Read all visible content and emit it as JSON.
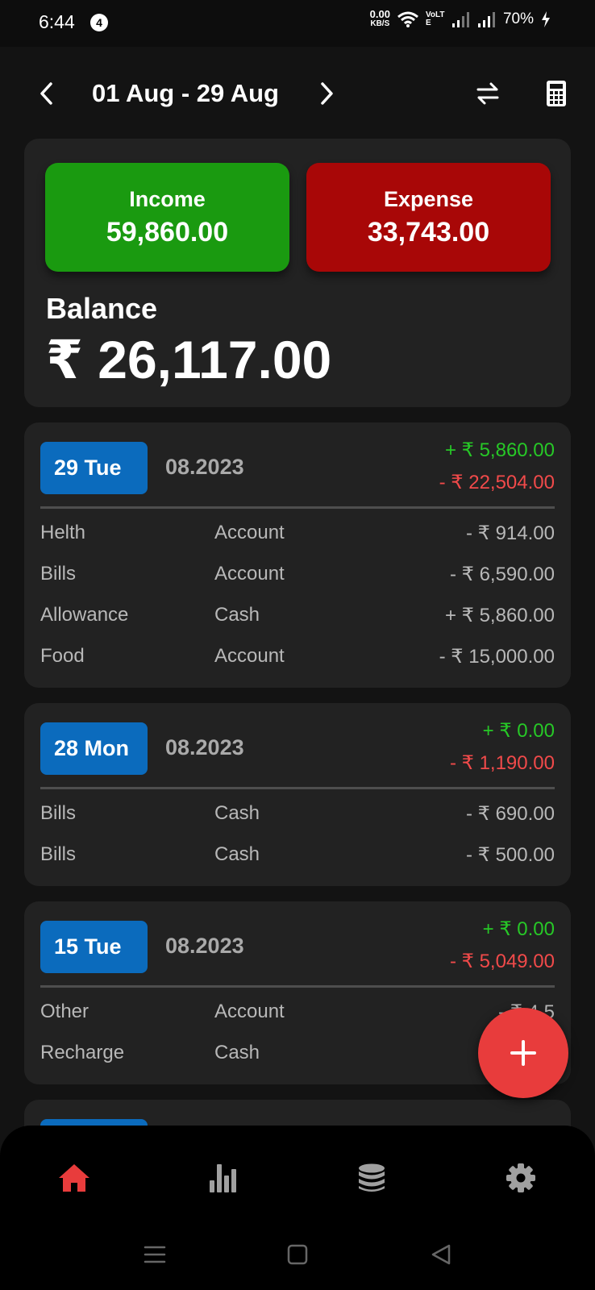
{
  "status_bar": {
    "time": "6:44",
    "notification_count": "4",
    "net_speed": "0.00",
    "net_speed_unit": "KB/S",
    "volte": "VoLTE",
    "battery": "70%"
  },
  "header": {
    "date_range": "01 Aug - 29 Aug",
    "icons": [
      "chevron-left-icon",
      "chevron-right-icon",
      "swap-icon",
      "calculator-icon"
    ]
  },
  "summary": {
    "income_label": "Income",
    "income_value": "59,860.00",
    "expense_label": "Expense",
    "expense_value": "33,743.00",
    "balance_label": "Balance",
    "balance_value": "₹ 26,117.00"
  },
  "days": [
    {
      "date": "29 Tue",
      "month_year": "08.2023",
      "income": "+ ₹ 5,860.00",
      "expense": "- ₹ 22,504.00",
      "transactions": [
        {
          "category": "Helth",
          "account": "Account",
          "amount": "- ₹ 914.00"
        },
        {
          "category": "Bills",
          "account": "Account",
          "amount": "- ₹ 6,590.00"
        },
        {
          "category": "Allowance",
          "account": "Cash",
          "amount": "+ ₹ 5,860.00"
        },
        {
          "category": "Food",
          "account": "Account",
          "amount": "- ₹ 15,000.00"
        }
      ]
    },
    {
      "date": "28 Mon",
      "month_year": "08.2023",
      "income": "+ ₹ 0.00",
      "expense": "- ₹ 1,190.00",
      "transactions": [
        {
          "category": "Bills",
          "account": "Cash",
          "amount": "- ₹ 690.00"
        },
        {
          "category": "Bills",
          "account": "Cash",
          "amount": "- ₹ 500.00"
        }
      ]
    },
    {
      "date": "15 Tue",
      "month_year": "08.2023",
      "income": "+ ₹ 0.00",
      "expense": "- ₹ 5,049.00",
      "transactions": [
        {
          "category": "Other",
          "account": "Account",
          "amount": "- ₹ 4,5"
        },
        {
          "category": "Recharge",
          "account": "Cash",
          "amount": "- "
        }
      ]
    }
  ],
  "bottom_nav": [
    "home-icon",
    "stats-icon",
    "accounts-icon",
    "settings-icon"
  ],
  "colors": {
    "income_green": "#1a9a10",
    "expense_red": "#a80707",
    "date_blue": "#0b6bbd",
    "accent_red": "#e83c3c",
    "positive_text": "#27c827",
    "negative_text": "#f14a4a"
  }
}
